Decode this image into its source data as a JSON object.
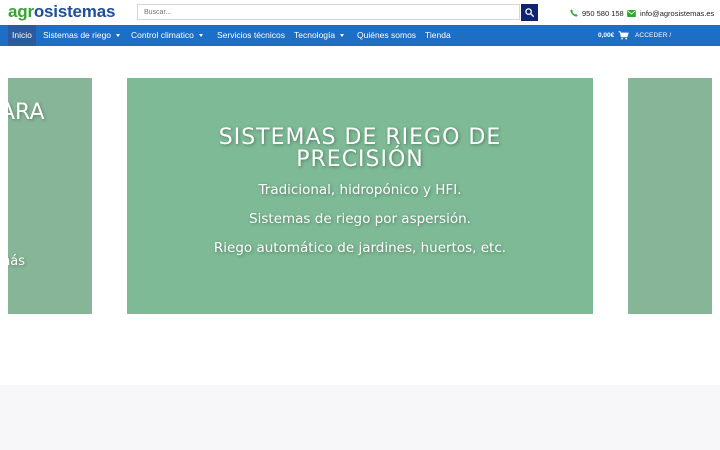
{
  "header": {
    "logo": {
      "part_green": "agr",
      "part_blue": "o",
      "part_rest": "sistemas"
    },
    "search": {
      "placeholder": "Buscar...",
      "value": ""
    },
    "phone": "950 580 158",
    "email": "info@agrosistemas.es",
    "colors": {
      "brand_green": "#3aa335",
      "brand_blue": "#1c4f9c",
      "search_button": "#0f2470"
    }
  },
  "nav": {
    "color": "#1c6fc4",
    "items": [
      {
        "label": "Inicio",
        "active": true,
        "dropdown": false
      },
      {
        "label": "Sistemas de riego",
        "active": false,
        "dropdown": true
      },
      {
        "label": "Control climatico",
        "active": false,
        "dropdown": true
      },
      {
        "label": "Servicios técnicos",
        "active": false,
        "dropdown": false
      },
      {
        "label": "Tecnología",
        "active": false,
        "dropdown": true
      },
      {
        "label": "Quiénes somos",
        "active": false,
        "dropdown": false
      },
      {
        "label": "Tienda",
        "active": false,
        "dropdown": false
      }
    ],
    "cart_total": "0,00€",
    "login": "ACCEDER / REGISTRARSE"
  },
  "slider": {
    "main": {
      "title_line1": "SISTEMAS DE RIEGO DE",
      "title_line2": "PRECISIÓN",
      "lines": [
        "Tradicional, hidropónico y HFI.",
        "Sistemas de riego por aspersión.",
        "Riego automático de jardines, huertos, etc."
      ],
      "color": "#7dba95"
    },
    "prev_partial": {
      "title_fragment": "ARA",
      "text_fragment": "nás"
    },
    "side_color": "#86b597"
  },
  "icons": {
    "search": "search-icon",
    "phone": "phone-icon",
    "email": "envelope-icon",
    "cart": "cart-icon"
  }
}
